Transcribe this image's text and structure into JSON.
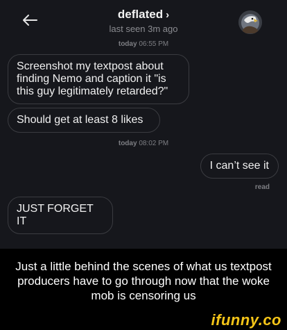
{
  "header": {
    "title": "deflated",
    "title_chevron": "›",
    "subtitle": "last seen 3m ago"
  },
  "stamps": [
    {
      "day": "today",
      "time": "06:55 PM"
    },
    {
      "day": "today",
      "time": "08:02 PM"
    }
  ],
  "messages": [
    {
      "side": "incoming",
      "text": "Screenshot my textpost about finding Nemo and caption it \"is this guy legitimately retarded?\""
    },
    {
      "side": "incoming",
      "text": "Should get at least 8 likes"
    },
    {
      "side": "outgoing",
      "text": "I can’t see it"
    },
    {
      "side": "incoming",
      "text": "JUST FORGET IT"
    }
  ],
  "read_receipt": "read",
  "caption": "Just a little behind the scenes of what us textpost producers have to go through now that the woke mob is censoring us",
  "watermark": "ifunny.co",
  "colors": {
    "chat_background": "#16171c",
    "bubble_border": "#3b3c41",
    "watermark": "#f5c518"
  },
  "icons": {
    "back": "back-arrow-icon",
    "avatar": "eagle-avatar"
  }
}
